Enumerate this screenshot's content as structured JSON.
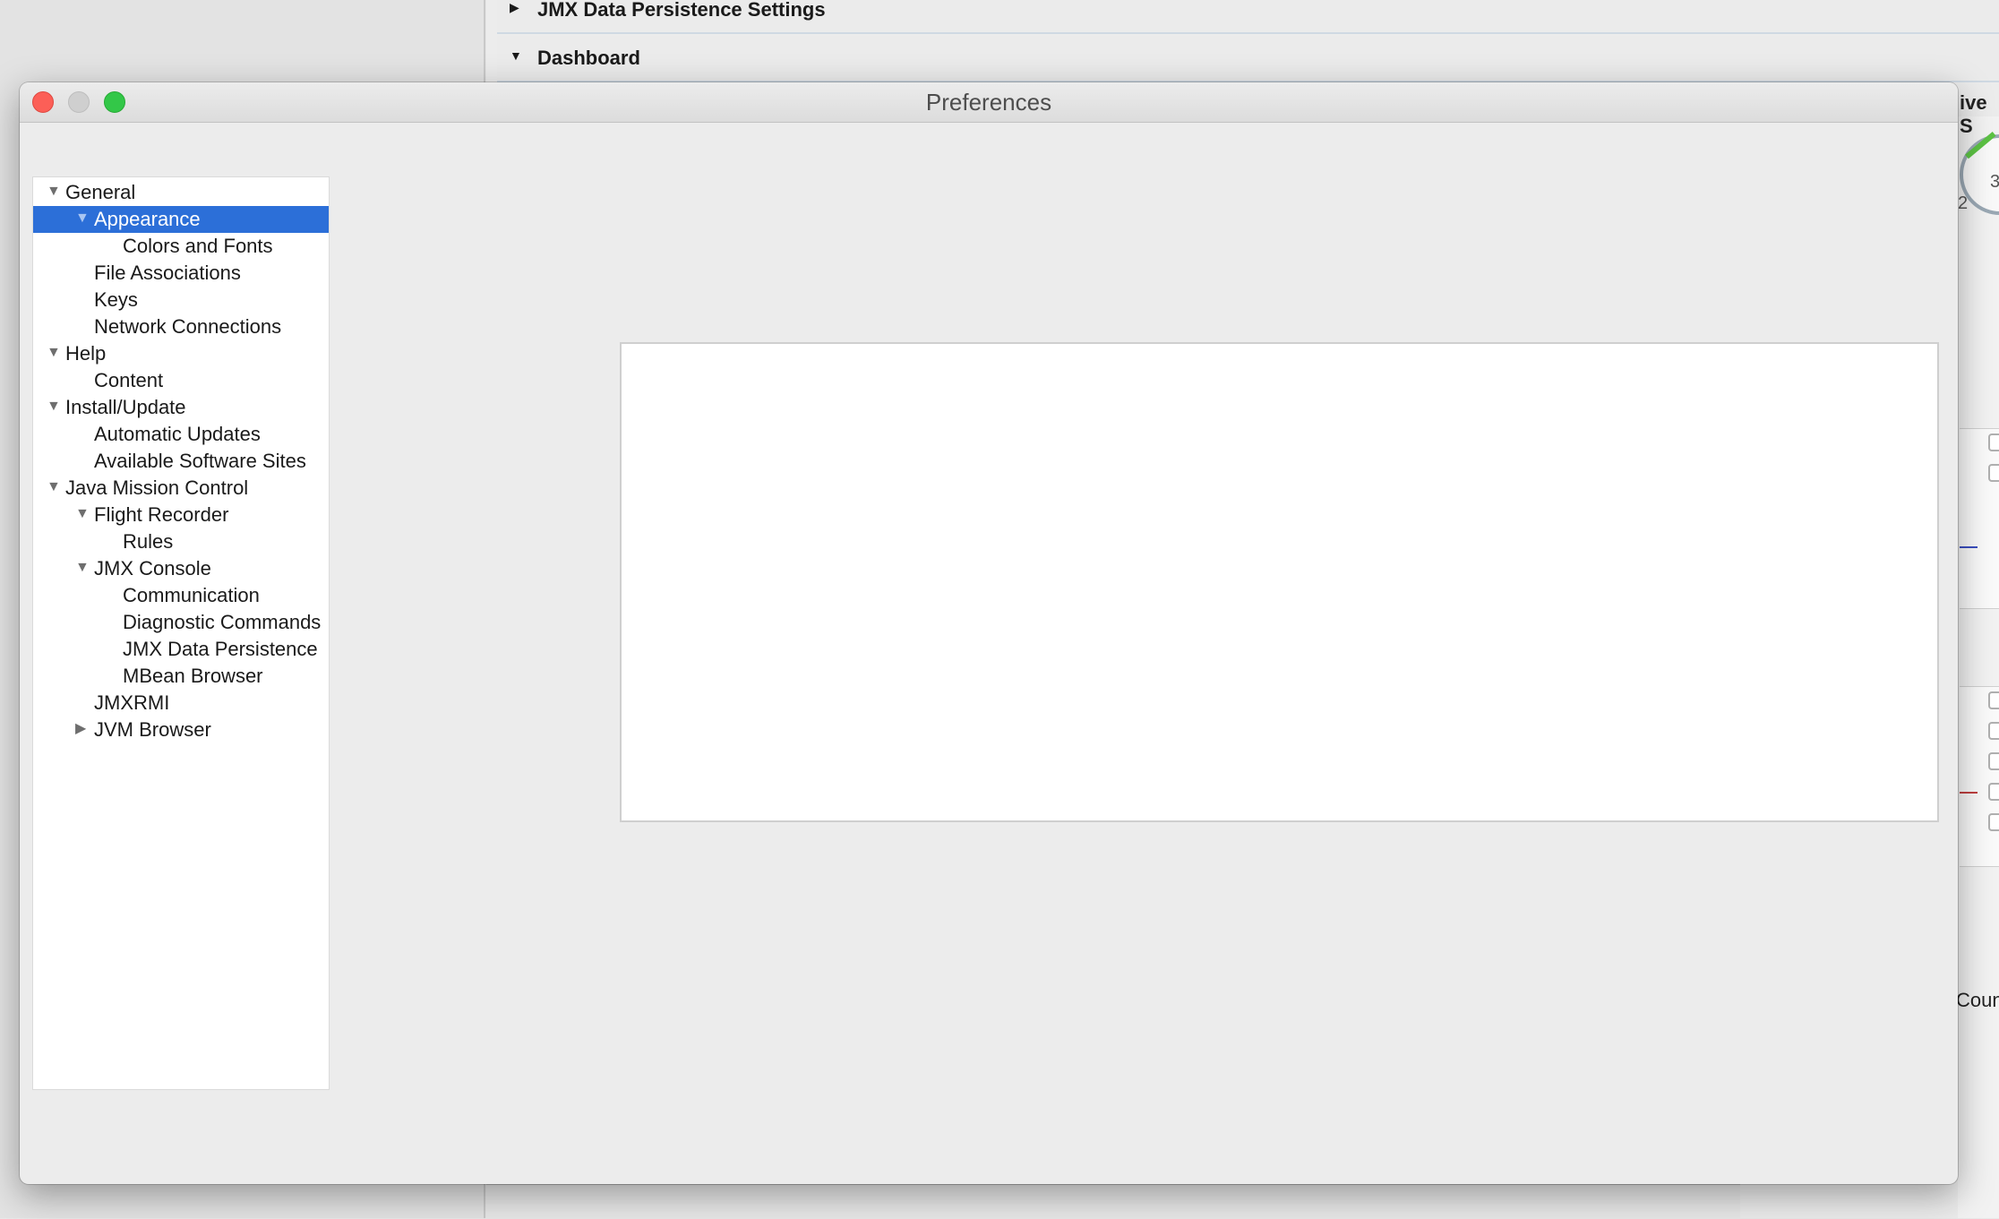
{
  "window": {
    "title": "Preferences"
  },
  "background": {
    "section_jmx": "JMX Data Persistence Settings",
    "section_dashboard": "Dashboard",
    "fragment_live": "ive S",
    "fragment_count": "Coun",
    "gauge_tick_2": "2",
    "gauge_tick_3": "3"
  },
  "tree": {
    "items": [
      {
        "label": "General",
        "level": 0,
        "expander": "expanded"
      },
      {
        "label": "Appearance",
        "level": 1,
        "expander": "expanded",
        "selected": true
      },
      {
        "label": "Colors and Fonts",
        "level": 2,
        "expander": "none"
      },
      {
        "label": "File Associations",
        "level": 1,
        "expander": "none"
      },
      {
        "label": "Keys",
        "level": 1,
        "expander": "none"
      },
      {
        "label": "Network Connections",
        "level": 1,
        "expander": "none"
      },
      {
        "label": "Help",
        "level": 0,
        "expander": "expanded"
      },
      {
        "label": "Content",
        "level": 1,
        "expander": "none"
      },
      {
        "label": "Install/Update",
        "level": 0,
        "expander": "expanded"
      },
      {
        "label": "Automatic Updates",
        "level": 1,
        "expander": "none"
      },
      {
        "label": "Available Software Sites",
        "level": 1,
        "expander": "none"
      },
      {
        "label": "Java Mission Control",
        "level": 0,
        "expander": "expanded"
      },
      {
        "label": "Flight Recorder",
        "level": 1,
        "expander": "expanded"
      },
      {
        "label": "Rules",
        "level": 2,
        "expander": "none"
      },
      {
        "label": "JMX Console",
        "level": 1,
        "expander": "expanded"
      },
      {
        "label": "Communication",
        "level": 2,
        "expander": "none"
      },
      {
        "label": "Diagnostic Commands",
        "level": 2,
        "expander": "none"
      },
      {
        "label": "JMX Data Persistence",
        "level": 2,
        "expander": "none"
      },
      {
        "label": "MBean Browser",
        "level": 2,
        "expander": "none"
      },
      {
        "label": "JMXRMI",
        "level": 1,
        "expander": "none"
      },
      {
        "label": "JVM Browser",
        "level": 1,
        "expander": "collapsed"
      }
    ]
  },
  "icons": {
    "expanded": "triangle-down-icon",
    "collapsed": "triangle-right-icon",
    "close": "close-icon",
    "minimize": "minimize-icon",
    "zoom": "zoom-icon"
  },
  "colors": {
    "selection": "#2c6fd8",
    "close": "#fc5f57",
    "zoom": "#33c748"
  }
}
